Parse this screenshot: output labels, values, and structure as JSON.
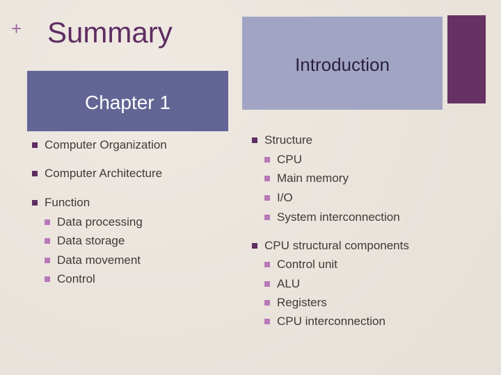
{
  "title": "Summary",
  "plus_glyph": "+",
  "intro_box": {
    "label": "Introduction"
  },
  "chapter_box": {
    "label": "Chapter 1"
  },
  "left_list": [
    {
      "text": "Computer Organization",
      "level": 1
    },
    {
      "text": "Computer Architecture",
      "level": 1
    },
    {
      "text": "Function",
      "level": 1
    },
    {
      "text": "Data processing",
      "level": 2
    },
    {
      "text": "Data storage",
      "level": 2
    },
    {
      "text": "Data movement",
      "level": 2
    },
    {
      "text": "Control",
      "level": 2
    }
  ],
  "right_list": [
    {
      "text": "Structure",
      "level": 1
    },
    {
      "text": "CPU",
      "level": 2
    },
    {
      "text": "Main memory",
      "level": 2
    },
    {
      "text": "I/O",
      "level": 2
    },
    {
      "text": "System interconnection",
      "level": 2
    },
    {
      "text": "CPU structural components",
      "level": 1
    },
    {
      "text": "Control unit",
      "level": 2
    },
    {
      "text": "ALU",
      "level": 2
    },
    {
      "text": "Registers",
      "level": 2
    },
    {
      "text": "CPU interconnection",
      "level": 2
    }
  ],
  "colors": {
    "title": "#5e2d62",
    "accent": "#663264",
    "intro_box": "#a2a4c4",
    "chapter_box": "#636595",
    "bullet_l1": "#5e2d62",
    "bullet_l2": "#b878b8"
  }
}
